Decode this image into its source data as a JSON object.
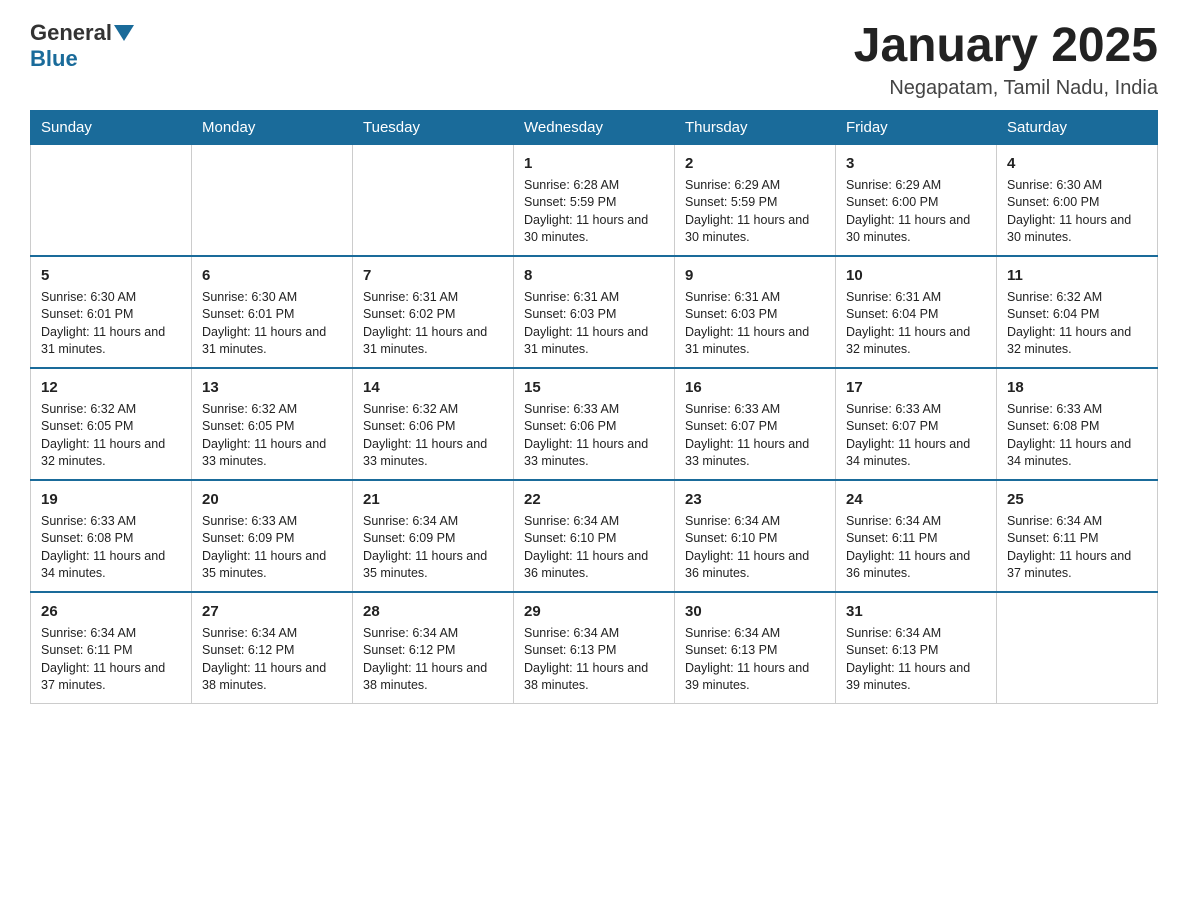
{
  "logo": {
    "general": "General",
    "blue": "Blue"
  },
  "title": "January 2025",
  "subtitle": "Negapatam, Tamil Nadu, India",
  "headers": [
    "Sunday",
    "Monday",
    "Tuesday",
    "Wednesday",
    "Thursday",
    "Friday",
    "Saturday"
  ],
  "weeks": [
    [
      {
        "day": "",
        "info": ""
      },
      {
        "day": "",
        "info": ""
      },
      {
        "day": "",
        "info": ""
      },
      {
        "day": "1",
        "info": "Sunrise: 6:28 AM\nSunset: 5:59 PM\nDaylight: 11 hours and 30 minutes."
      },
      {
        "day": "2",
        "info": "Sunrise: 6:29 AM\nSunset: 5:59 PM\nDaylight: 11 hours and 30 minutes."
      },
      {
        "day": "3",
        "info": "Sunrise: 6:29 AM\nSunset: 6:00 PM\nDaylight: 11 hours and 30 minutes."
      },
      {
        "day": "4",
        "info": "Sunrise: 6:30 AM\nSunset: 6:00 PM\nDaylight: 11 hours and 30 minutes."
      }
    ],
    [
      {
        "day": "5",
        "info": "Sunrise: 6:30 AM\nSunset: 6:01 PM\nDaylight: 11 hours and 31 minutes."
      },
      {
        "day": "6",
        "info": "Sunrise: 6:30 AM\nSunset: 6:01 PM\nDaylight: 11 hours and 31 minutes."
      },
      {
        "day": "7",
        "info": "Sunrise: 6:31 AM\nSunset: 6:02 PM\nDaylight: 11 hours and 31 minutes."
      },
      {
        "day": "8",
        "info": "Sunrise: 6:31 AM\nSunset: 6:03 PM\nDaylight: 11 hours and 31 minutes."
      },
      {
        "day": "9",
        "info": "Sunrise: 6:31 AM\nSunset: 6:03 PM\nDaylight: 11 hours and 31 minutes."
      },
      {
        "day": "10",
        "info": "Sunrise: 6:31 AM\nSunset: 6:04 PM\nDaylight: 11 hours and 32 minutes."
      },
      {
        "day": "11",
        "info": "Sunrise: 6:32 AM\nSunset: 6:04 PM\nDaylight: 11 hours and 32 minutes."
      }
    ],
    [
      {
        "day": "12",
        "info": "Sunrise: 6:32 AM\nSunset: 6:05 PM\nDaylight: 11 hours and 32 minutes."
      },
      {
        "day": "13",
        "info": "Sunrise: 6:32 AM\nSunset: 6:05 PM\nDaylight: 11 hours and 33 minutes."
      },
      {
        "day": "14",
        "info": "Sunrise: 6:32 AM\nSunset: 6:06 PM\nDaylight: 11 hours and 33 minutes."
      },
      {
        "day": "15",
        "info": "Sunrise: 6:33 AM\nSunset: 6:06 PM\nDaylight: 11 hours and 33 minutes."
      },
      {
        "day": "16",
        "info": "Sunrise: 6:33 AM\nSunset: 6:07 PM\nDaylight: 11 hours and 33 minutes."
      },
      {
        "day": "17",
        "info": "Sunrise: 6:33 AM\nSunset: 6:07 PM\nDaylight: 11 hours and 34 minutes."
      },
      {
        "day": "18",
        "info": "Sunrise: 6:33 AM\nSunset: 6:08 PM\nDaylight: 11 hours and 34 minutes."
      }
    ],
    [
      {
        "day": "19",
        "info": "Sunrise: 6:33 AM\nSunset: 6:08 PM\nDaylight: 11 hours and 34 minutes."
      },
      {
        "day": "20",
        "info": "Sunrise: 6:33 AM\nSunset: 6:09 PM\nDaylight: 11 hours and 35 minutes."
      },
      {
        "day": "21",
        "info": "Sunrise: 6:34 AM\nSunset: 6:09 PM\nDaylight: 11 hours and 35 minutes."
      },
      {
        "day": "22",
        "info": "Sunrise: 6:34 AM\nSunset: 6:10 PM\nDaylight: 11 hours and 36 minutes."
      },
      {
        "day": "23",
        "info": "Sunrise: 6:34 AM\nSunset: 6:10 PM\nDaylight: 11 hours and 36 minutes."
      },
      {
        "day": "24",
        "info": "Sunrise: 6:34 AM\nSunset: 6:11 PM\nDaylight: 11 hours and 36 minutes."
      },
      {
        "day": "25",
        "info": "Sunrise: 6:34 AM\nSunset: 6:11 PM\nDaylight: 11 hours and 37 minutes."
      }
    ],
    [
      {
        "day": "26",
        "info": "Sunrise: 6:34 AM\nSunset: 6:11 PM\nDaylight: 11 hours and 37 minutes."
      },
      {
        "day": "27",
        "info": "Sunrise: 6:34 AM\nSunset: 6:12 PM\nDaylight: 11 hours and 38 minutes."
      },
      {
        "day": "28",
        "info": "Sunrise: 6:34 AM\nSunset: 6:12 PM\nDaylight: 11 hours and 38 minutes."
      },
      {
        "day": "29",
        "info": "Sunrise: 6:34 AM\nSunset: 6:13 PM\nDaylight: 11 hours and 38 minutes."
      },
      {
        "day": "30",
        "info": "Sunrise: 6:34 AM\nSunset: 6:13 PM\nDaylight: 11 hours and 39 minutes."
      },
      {
        "day": "31",
        "info": "Sunrise: 6:34 AM\nSunset: 6:13 PM\nDaylight: 11 hours and 39 minutes."
      },
      {
        "day": "",
        "info": ""
      }
    ]
  ]
}
